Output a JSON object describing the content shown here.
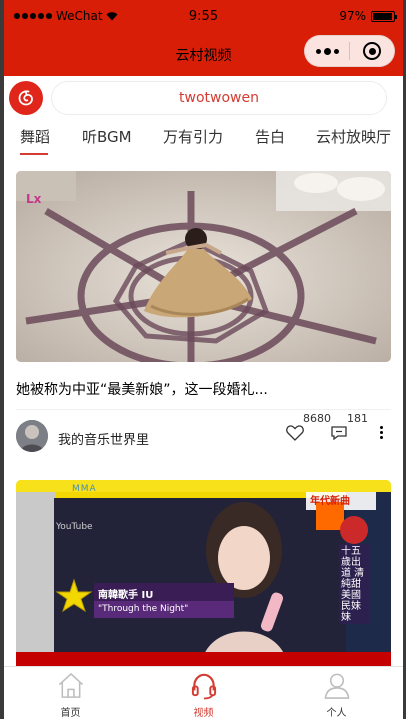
{
  "status_bar": {
    "carrier": "WeChat",
    "time": "9:55",
    "battery": "97%",
    "battery_level": 0.97
  },
  "nav": {
    "title": "云村视频"
  },
  "search": {
    "placeholder": "twotwowen"
  },
  "tabs": [
    {
      "label": "舞蹈",
      "active": true
    },
    {
      "label": "听BGM",
      "active": false
    },
    {
      "label": "万有引力",
      "active": false
    },
    {
      "label": "告白",
      "active": false
    },
    {
      "label": "云村放映厅",
      "active": false
    }
  ],
  "videos": [
    {
      "title": "她被称为中亚“最美新娘”，这一段婚礼...",
      "author": "我的音乐世界里",
      "likes": "8680",
      "comments": "181"
    },
    {
      "overlay_top_right": "年代新曲",
      "overlay_vertical": "十五歲出道 清純甜美國民妹妹",
      "caption_name": "南韓歌手 IU",
      "caption_song": "\"Through the Night\"",
      "watermark": "YouTube",
      "logo_text": "MMA"
    }
  ],
  "tabbar": [
    {
      "label": "首页",
      "icon": "home-icon",
      "active": false
    },
    {
      "label": "视频",
      "icon": "headphones-icon",
      "active": true
    },
    {
      "label": "个人",
      "icon": "person-icon",
      "active": false
    }
  ],
  "colors": {
    "brand_red": "#d81e06",
    "accent_red": "#d43c33"
  }
}
